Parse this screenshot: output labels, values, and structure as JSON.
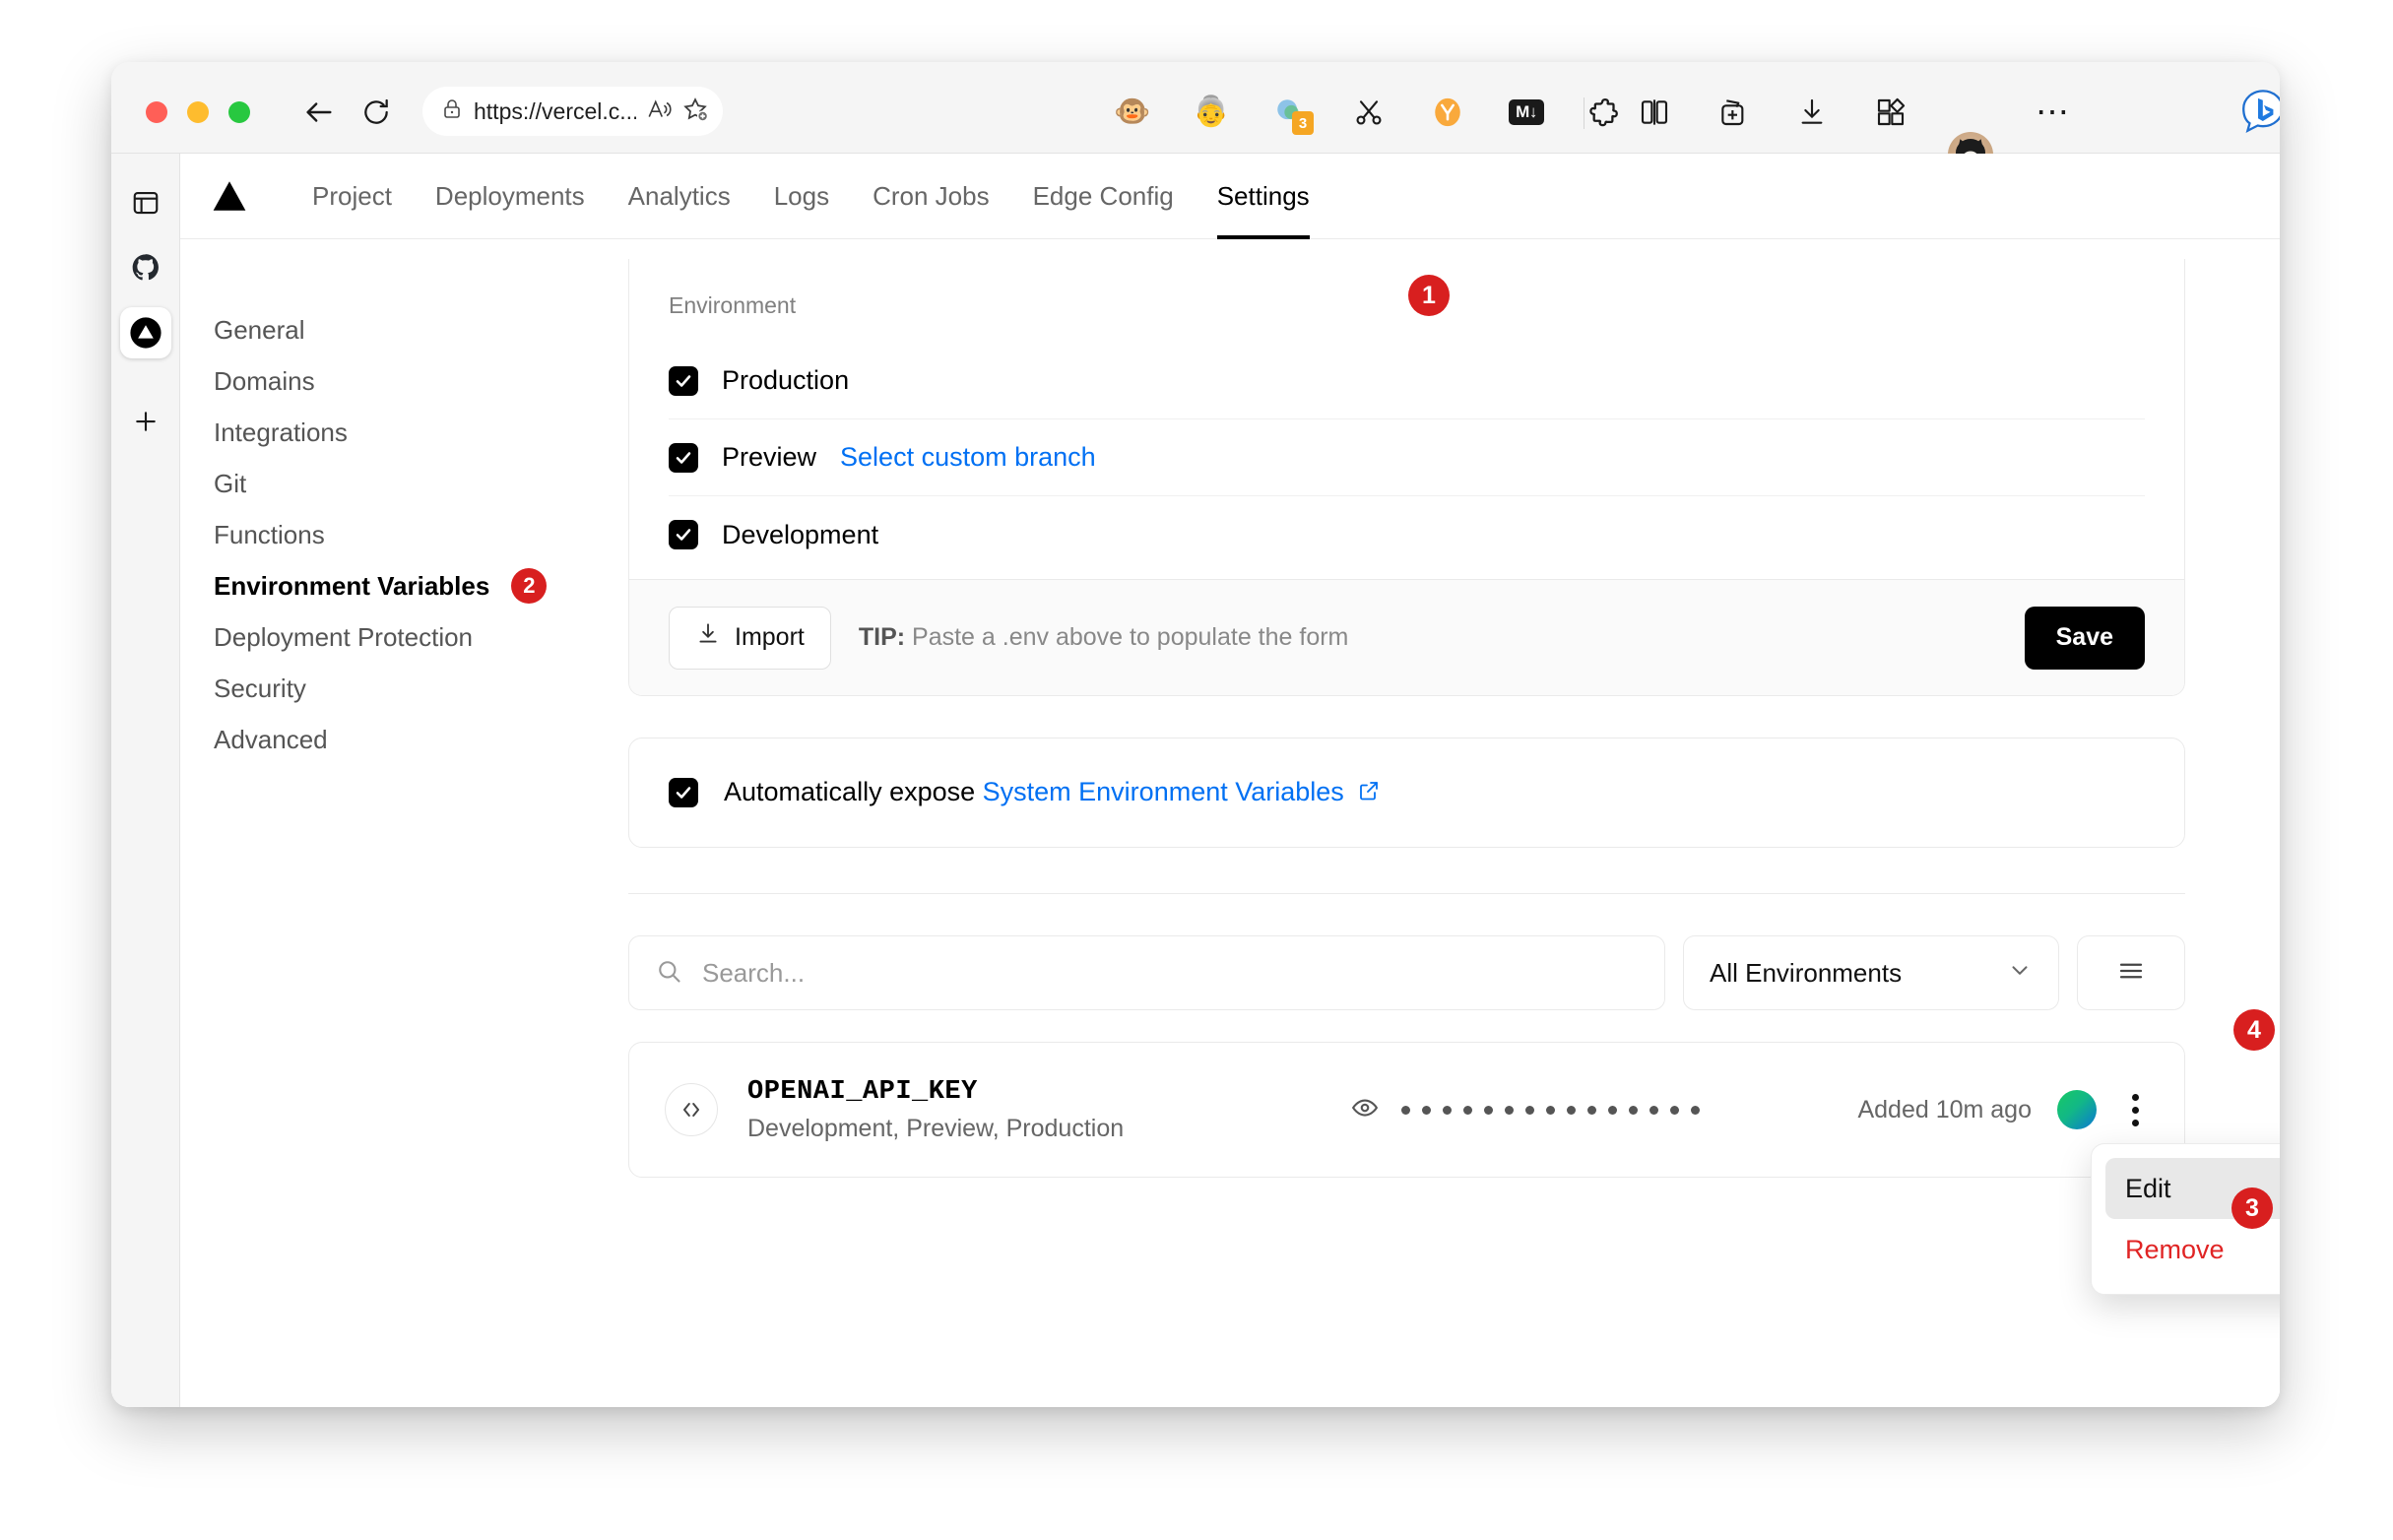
{
  "browser": {
    "url": "https://vercel.c...",
    "url_prefix": "https://",
    "url_rest": "vercel.c...",
    "back_icon": "back-arrow-icon",
    "reload_icon": "reload-icon",
    "lock_icon": "lock-icon",
    "read_aloud_icon": "read-aloud-icon",
    "favorite_icon": "add-favorite-icon",
    "toolbar_icons": [
      {
        "name": "monkey-extension-icon",
        "glyph": "🐵"
      },
      {
        "name": "face-extension-icon",
        "glyph": "👵"
      },
      {
        "name": "tab-groups-icon",
        "badge": "3"
      },
      {
        "name": "scissors-icon",
        "glyph": "✂"
      },
      {
        "name": "orange-extension-icon",
        "glyph": "Ⓦ"
      },
      {
        "name": "markdown-icon",
        "glyph": "M↓"
      },
      {
        "name": "puzzle-extension-icon",
        "glyph": "✦"
      },
      {
        "name": "split-screen-icon"
      },
      {
        "name": "add-collection-icon"
      },
      {
        "name": "downloads-icon"
      },
      {
        "name": "extensions-icon"
      }
    ],
    "profile_name": "profile-avatar",
    "more_label": "⋯",
    "bing_label": "b"
  },
  "edge_rail": [
    {
      "name": "sidebar-panel-icon",
      "active": false
    },
    {
      "name": "github-icon",
      "active": false
    },
    {
      "name": "vercel-icon",
      "active": true
    },
    {
      "name": "add-tab-icon",
      "active": false
    }
  ],
  "topnav": {
    "logo": "vercel-triangle-logo",
    "items": [
      {
        "label": "Project",
        "active": false
      },
      {
        "label": "Deployments",
        "active": false
      },
      {
        "label": "Analytics",
        "active": false
      },
      {
        "label": "Logs",
        "active": false
      },
      {
        "label": "Cron Jobs",
        "active": false
      },
      {
        "label": "Edge Config",
        "active": false
      },
      {
        "label": "Settings",
        "active": true
      }
    ]
  },
  "sidebar": {
    "items": [
      {
        "label": "General",
        "active": false,
        "badge": null
      },
      {
        "label": "Domains",
        "active": false,
        "badge": null
      },
      {
        "label": "Integrations",
        "active": false,
        "badge": null
      },
      {
        "label": "Git",
        "active": false,
        "badge": null
      },
      {
        "label": "Functions",
        "active": false,
        "badge": null
      },
      {
        "label": "Environment Variables",
        "active": true,
        "badge": "2"
      },
      {
        "label": "Deployment Protection",
        "active": false,
        "badge": null
      },
      {
        "label": "Security",
        "active": false,
        "badge": null
      },
      {
        "label": "Advanced",
        "active": false,
        "badge": null
      }
    ]
  },
  "env_form": {
    "section_label": "Environment",
    "checkboxes": [
      {
        "label": "Production",
        "checked": true,
        "link": null
      },
      {
        "label": "Preview",
        "checked": true,
        "link": "Select custom branch"
      },
      {
        "label": "Development",
        "checked": true,
        "link": null
      }
    ],
    "import_label": "Import",
    "import_icon": "download-icon",
    "tip_prefix": "TIP:",
    "tip_text": " Paste a .env above to populate the form",
    "save_label": "Save"
  },
  "system_env": {
    "checked": true,
    "text_before": "Automatically expose ",
    "link_text": "System Environment Variables",
    "external_icon": "external-link-icon"
  },
  "filters": {
    "search_placeholder": "Search...",
    "search_value": "",
    "search_icon": "search-icon",
    "environment_filter": "All Environments",
    "chevron_icon": "chevron-down-icon",
    "view_toggle_icon": "list-view-icon"
  },
  "env_vars": [
    {
      "key": "OPENAI_API_KEY",
      "environments": "Development, Preview, Production",
      "code_icon": "code-brackets-icon",
      "eye_icon": "eye-icon",
      "masked_dots": 15,
      "added": "Added 10m ago",
      "avatar": "user-avatar",
      "menu_icon": "kebab-menu-icon"
    }
  ],
  "context_menu": {
    "items": [
      {
        "label": "Edit",
        "danger": false,
        "hovered": true
      },
      {
        "label": "Remove",
        "danger": true,
        "hovered": false
      }
    ]
  },
  "annotations": [
    {
      "id": "1",
      "number": "1"
    },
    {
      "id": "2",
      "number": "2"
    },
    {
      "id": "3",
      "number": "3"
    },
    {
      "id": "4",
      "number": "4"
    }
  ],
  "colors": {
    "accent_link": "#0070f3",
    "danger": "#e02424",
    "annotation": "#d81f1f",
    "black": "#000000"
  }
}
